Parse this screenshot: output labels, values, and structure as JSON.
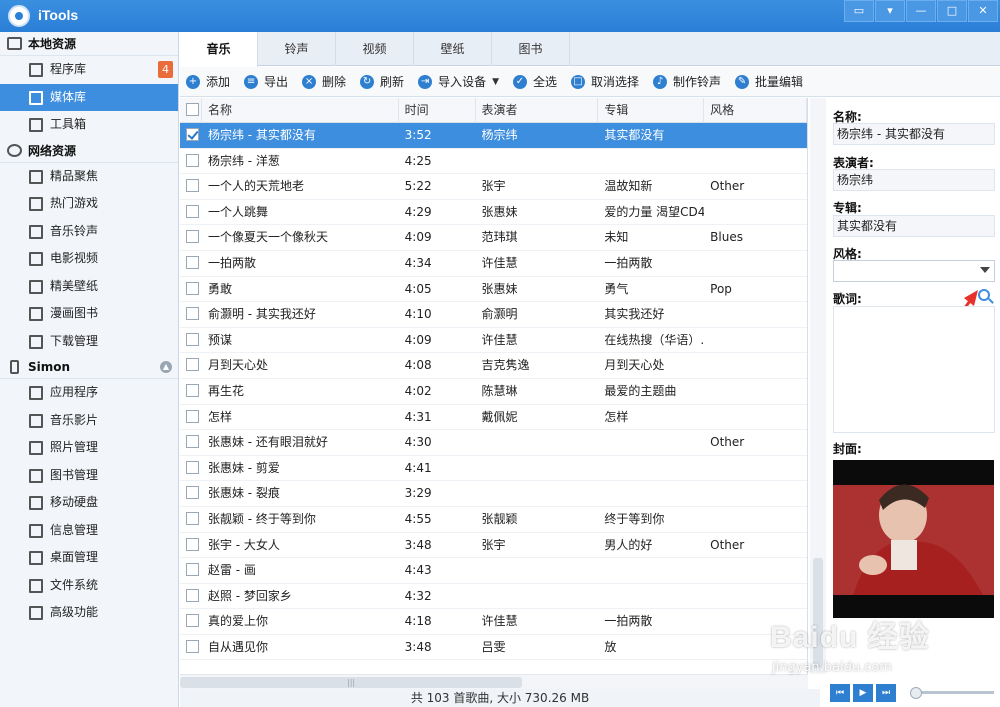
{
  "app": {
    "title": "iTools"
  },
  "sidebar": {
    "groups": [
      {
        "header": "本地资源",
        "items": [
          {
            "label": "程序库",
            "badge": "4"
          },
          {
            "label": "媒体库"
          },
          {
            "label": "工具箱"
          }
        ]
      },
      {
        "header": "网络资源",
        "items": [
          {
            "label": "精品聚焦"
          },
          {
            "label": "热门游戏"
          },
          {
            "label": "音乐铃声"
          },
          {
            "label": "电影视频"
          },
          {
            "label": "精美壁纸"
          },
          {
            "label": "漫画图书"
          },
          {
            "label": "下载管理"
          }
        ]
      },
      {
        "header": "Simon",
        "items": [
          {
            "label": "应用程序"
          },
          {
            "label": "音乐影片"
          },
          {
            "label": "照片管理"
          },
          {
            "label": "图书管理"
          },
          {
            "label": "移动硬盘"
          },
          {
            "label": "信息管理"
          },
          {
            "label": "桌面管理"
          },
          {
            "label": "文件系统"
          },
          {
            "label": "高级功能"
          }
        ]
      }
    ]
  },
  "tabs": [
    "音乐",
    "铃声",
    "视频",
    "壁纸",
    "图书"
  ],
  "toolbar": {
    "add": "添加",
    "export": "导出",
    "delete": "删除",
    "refresh": "刷新",
    "import": "导入设备",
    "select_all": "全选",
    "deselect": "取消选择",
    "make_ringtone": "制作铃声",
    "batch_edit": "批量编辑"
  },
  "table": {
    "columns": [
      "名称",
      "时间",
      "表演者",
      "专辑",
      "风格"
    ],
    "rows": [
      [
        "杨宗纬 - 其实都没有",
        "3:52",
        "杨宗纬",
        "其实都没有",
        ""
      ],
      [
        "杨宗纬 - 洋葱",
        "4:25",
        "",
        "",
        ""
      ],
      [
        "一个人的天荒地老",
        "5:22",
        "张宇",
        "温故知新",
        "Other"
      ],
      [
        "一个人跳舞",
        "4:29",
        "张惠妹",
        "爱的力量 渴望CD4",
        ""
      ],
      [
        "一个像夏天一个像秋天",
        "4:09",
        "范玮琪",
        "未知",
        "Blues"
      ],
      [
        "一拍两散",
        "4:34",
        "许佳慧",
        "一拍两散",
        ""
      ],
      [
        "勇敢",
        "4:05",
        "张惠妹",
        "勇气",
        "Pop"
      ],
      [
        "俞灏明 - 其实我还好",
        "4:10",
        "俞灏明",
        "其实我还好",
        ""
      ],
      [
        "预谋",
        "4:09",
        "许佳慧",
        "在线热搜（华语）...",
        ""
      ],
      [
        "月到天心处",
        "4:08",
        "吉克隽逸",
        "月到天心处",
        ""
      ],
      [
        "再生花",
        "4:02",
        "陈慧琳",
        "最爱的主题曲",
        ""
      ],
      [
        "怎样",
        "4:31",
        "戴佩妮",
        "怎样",
        ""
      ],
      [
        "张惠妹 - 还有眼泪就好",
        "4:30",
        "",
        "",
        "Other"
      ],
      [
        "张惠妹 - 剪爱",
        "4:41",
        "",
        "",
        ""
      ],
      [
        "张惠妹 - 裂痕",
        "3:29",
        "",
        "",
        ""
      ],
      [
        "张靓颖 - 终于等到你",
        "4:55",
        "张靓颖",
        "终于等到你",
        ""
      ],
      [
        "张宇 - 大女人",
        "3:48",
        "张宇",
        "男人的好",
        "Other"
      ],
      [
        "赵雷 - 画",
        "4:43",
        "",
        "",
        ""
      ],
      [
        "赵照 - 梦回家乡",
        "4:32",
        "",
        "",
        ""
      ],
      [
        "真的爱上你",
        "4:18",
        "许佳慧",
        "一拍两散",
        ""
      ],
      [
        "自从遇见你",
        "3:48",
        "吕雯",
        "放",
        ""
      ]
    ]
  },
  "status": "共 103 首歌曲, 大小 730.26 MB",
  "details": {
    "name_label": "名称:",
    "name_value": "杨宗纬 - 其实都没有",
    "artist_label": "表演者:",
    "artist_value": "杨宗纬",
    "album_label": "专辑:",
    "album_value": "其实都没有",
    "genre_label": "风格:",
    "lyrics_label": "歌词:",
    "cover_label": "封面:"
  },
  "watermark": {
    "main": "Baidu 经验",
    "sub": "jingyan.baidu.com"
  },
  "colors": {
    "accent": "#3d8ede",
    "titlebar": "#2a7fd6",
    "badge": "#ea6c3a",
    "arrow": "#e8312a"
  }
}
